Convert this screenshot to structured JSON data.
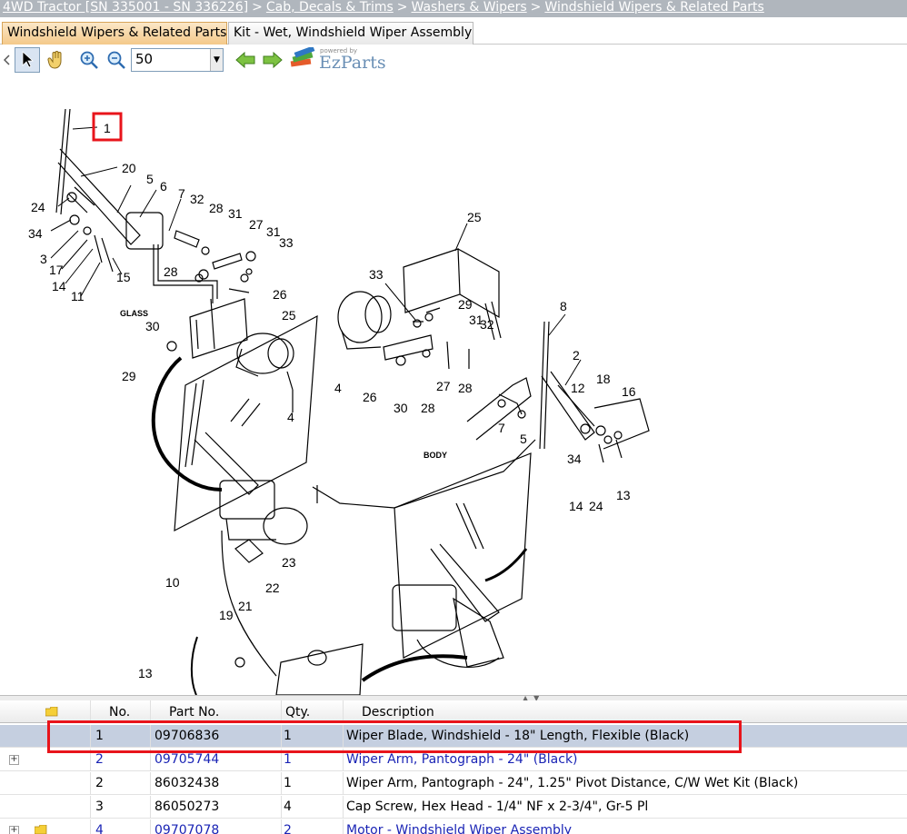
{
  "breadcrumb": {
    "items": [
      "4WD Tractor [SN 335001 - SN 336226]",
      "Cab, Decals & Trims",
      "Washers & Wipers",
      "Windshield Wipers & Related Parts"
    ],
    "separator": ">"
  },
  "tabs": [
    {
      "label": "Windshield Wipers & Related Parts",
      "active": true
    },
    {
      "label": "Kit - Wet, Windshield Wiper Assembly",
      "active": false
    }
  ],
  "toolbar": {
    "zoom_value": "50",
    "icons": [
      "left-arrow-icon",
      "pointer-icon",
      "hand-icon",
      "zoom-in-icon",
      "zoom-out-icon",
      "back-arrow-icon",
      "forward-arrow-icon"
    ],
    "logo_powered_by": "powered by",
    "logo_text": "EzParts"
  },
  "diagram": {
    "callout_labels": [
      "1",
      "20",
      "5",
      "6",
      "7",
      "32",
      "28",
      "31",
      "27",
      "31",
      "33",
      "24",
      "34",
      "3",
      "17",
      "14",
      "11",
      "15",
      "GLASS",
      "28",
      "26",
      "30",
      "25",
      "29",
      "4",
      "25",
      "33",
      "29",
      "31",
      "32",
      "4",
      "26",
      "30",
      "28",
      "27",
      "28",
      "8",
      "2",
      "12",
      "18",
      "16",
      "7",
      "5",
      "BODY",
      "34",
      "14",
      "24",
      "13",
      "10",
      "23",
      "22",
      "21",
      "19",
      "13"
    ],
    "highlighted_callout": "1",
    "colors": {
      "highlight": "#e8141b",
      "arrow": "#000000"
    }
  },
  "parts_table": {
    "headers": {
      "no": "No.",
      "part_no": "Part No.",
      "qty": "Qty.",
      "description": "Description"
    },
    "rows": [
      {
        "no": "1",
        "part_no": "09706836",
        "qty": "1",
        "description": "Wiper Blade, Windshield - 18\" Length, Flexible (Black)",
        "selected": true,
        "expandable": false,
        "kit": false,
        "link": false
      },
      {
        "no": "2",
        "part_no": "09705744",
        "qty": "1",
        "description": "Wiper Arm, Pantograph - 24\" (Black)",
        "selected": false,
        "expandable": true,
        "kit": false,
        "link": true
      },
      {
        "no": "2",
        "part_no": "86032438",
        "qty": "1",
        "description": "Wiper Arm, Pantograph - 24\", 1.25\" Pivot Distance, C/W Wet Kit (Black)",
        "selected": false,
        "expandable": false,
        "kit": false,
        "link": false
      },
      {
        "no": "3",
        "part_no": "86050273",
        "qty": "4",
        "description": "Cap Screw, Hex Head - 1/4\" NF x 2-3/4\", Gr-5 Pl",
        "selected": false,
        "expandable": false,
        "kit": false,
        "link": false
      },
      {
        "no": "4",
        "part_no": "09707078",
        "qty": "2",
        "description": "Motor - Windshield Wiper Assembly",
        "selected": false,
        "expandable": true,
        "kit": true,
        "link": true
      }
    ],
    "colors": {
      "selected_row": "#c5cfe0",
      "link_text": "#1a24b5",
      "highlight_box": "#e8141b"
    }
  }
}
